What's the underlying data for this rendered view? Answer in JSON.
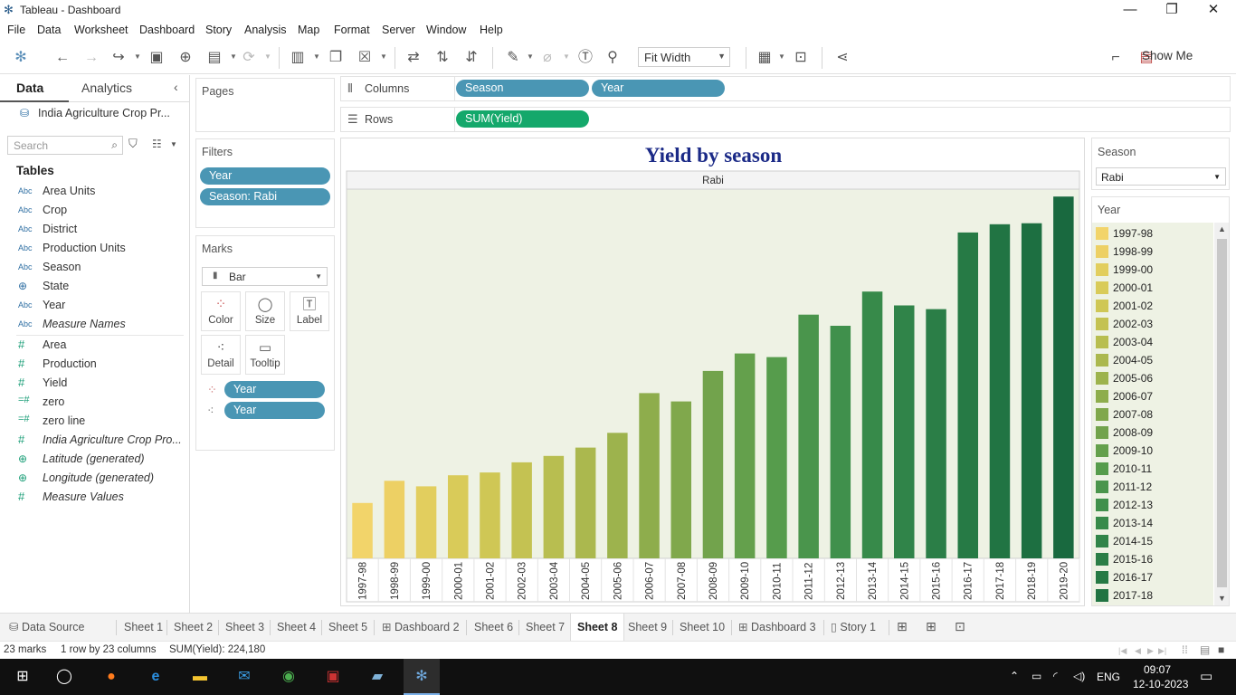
{
  "window": {
    "title": "Tableau - Dashboard",
    "minimize": "—",
    "maximize": "❐",
    "close": "✕"
  },
  "menu": [
    "File",
    "Data",
    "Worksheet",
    "Dashboard",
    "Story",
    "Analysis",
    "Map",
    "Format",
    "Server",
    "Window",
    "Help"
  ],
  "toolbar": {
    "fit_value": "Fit Width",
    "show_me": "Show Me"
  },
  "left_pane": {
    "tab_data": "Data",
    "tab_analytics": "Analytics",
    "datasource": "India Agriculture Crop Pr...",
    "search_placeholder": "Search",
    "tables_heading": "Tables",
    "dimensions": [
      {
        "icon": "Abc",
        "label": "Area Units"
      },
      {
        "icon": "Abc",
        "label": "Crop"
      },
      {
        "icon": "Abc",
        "label": "District"
      },
      {
        "icon": "Abc",
        "label": "Production Units"
      },
      {
        "icon": "Abc",
        "label": "Season"
      },
      {
        "icon": "⊕",
        "label": "State"
      },
      {
        "icon": "Abc",
        "label": "Year"
      },
      {
        "icon": "Abc",
        "label": "Measure Names"
      }
    ],
    "measures": [
      {
        "icon": "#",
        "label": "Area"
      },
      {
        "icon": "#",
        "label": "Production"
      },
      {
        "icon": "#",
        "label": "Yield"
      },
      {
        "icon": "=#",
        "label": "zero"
      },
      {
        "icon": "=#",
        "label": "zero line"
      },
      {
        "icon": "#",
        "label": "India Agriculture Crop Pro..."
      },
      {
        "icon": "⊕",
        "label": "Latitude (generated)"
      },
      {
        "icon": "⊕",
        "label": "Longitude (generated)"
      },
      {
        "icon": "#",
        "label": "Measure Values"
      }
    ]
  },
  "cards": {
    "pages": "Pages",
    "filters": "Filters",
    "filter_pills": [
      "Year",
      "Season: Rabi"
    ],
    "marks": "Marks",
    "mark_type": "Bar",
    "mark_buttons": [
      "Color",
      "Size",
      "Label",
      "Detail",
      "Tooltip"
    ],
    "mark_pills": [
      "Year",
      "Year"
    ]
  },
  "shelves": {
    "columns_label": "Columns",
    "rows_label": "Rows",
    "columns_pills": [
      "Season",
      "Year"
    ],
    "rows_pills": [
      "SUM(Yield)"
    ]
  },
  "chart_data": {
    "type": "bar",
    "title": "Yield by season",
    "panel_header": "Rabi",
    "categories": [
      "1997-98",
      "1998-99",
      "1999-00",
      "2000-01",
      "2001-02",
      "2002-03",
      "2003-04",
      "2004-05",
      "2005-06",
      "2006-07",
      "2007-08",
      "2008-09",
      "2009-10",
      "2010-11",
      "2011-12",
      "2012-13",
      "2013-14",
      "2014-15",
      "2015-16",
      "2016-17",
      "2017-18",
      "2018-19",
      "2019-20"
    ],
    "values": [
      60,
      84,
      78,
      90,
      93,
      104,
      111,
      120,
      136,
      179,
      170,
      203,
      222,
      218,
      264,
      252,
      289,
      274,
      270,
      353,
      362,
      363,
      392
    ],
    "colors": [
      "#f2d46a",
      "#edd064",
      "#e2ce5e",
      "#d9cb59",
      "#cfc755",
      "#c4c252",
      "#b8be50",
      "#abb84e",
      "#9db34d",
      "#8ead4c",
      "#80a84c",
      "#72a34c",
      "#64a04c",
      "#569c4c",
      "#4a954c",
      "#40904c",
      "#378a4a",
      "#308449",
      "#2b7e47",
      "#267a45",
      "#217443",
      "#1d6f41",
      "#19693f"
    ],
    "plot_bg": "#eef2e4",
    "ylim": [
      0,
      400
    ],
    "grid": false
  },
  "legends": {
    "season_title": "Season",
    "season_value": "Rabi",
    "year_title": "Year",
    "year_items": [
      "1997-98",
      "1998-99",
      "1999-00",
      "2000-01",
      "2001-02",
      "2002-03",
      "2003-04",
      "2004-05",
      "2005-06",
      "2006-07",
      "2007-08",
      "2008-09",
      "2009-10",
      "2010-11",
      "2011-12",
      "2012-13",
      "2013-14",
      "2014-15",
      "2015-16",
      "2016-17",
      "2017-18"
    ]
  },
  "tabs": [
    {
      "label": "Data Source",
      "icon": "⛁"
    },
    {
      "label": "Sheet 1"
    },
    {
      "label": "Sheet 2"
    },
    {
      "label": "Sheet 3"
    },
    {
      "label": "Sheet 4"
    },
    {
      "label": "Sheet 5"
    },
    {
      "label": "Dashboard 2",
      "icon": "⊞"
    },
    {
      "label": "Sheet 6"
    },
    {
      "label": "Sheet 7"
    },
    {
      "label": "Sheet 8",
      "active": true
    },
    {
      "label": "Sheet 9"
    },
    {
      "label": "Sheet 10"
    },
    {
      "label": "Dashboard 3",
      "icon": "⊞"
    },
    {
      "label": "Story 1",
      "icon": "▯"
    }
  ],
  "status": {
    "marks": "23 marks",
    "dims": "1 row by 23 columns",
    "sum": "SUM(Yield): 224,180"
  },
  "tray": {
    "lang": "ENG",
    "time": "09:07",
    "date": "12-10-2023"
  }
}
